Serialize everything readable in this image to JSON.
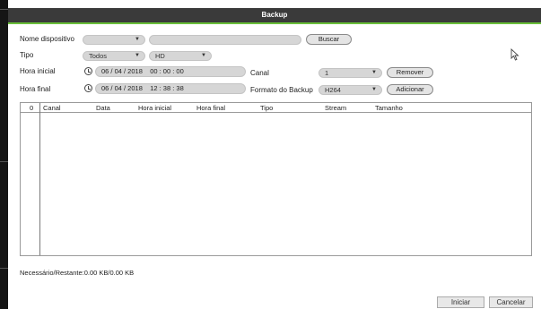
{
  "window": {
    "title": "Backup"
  },
  "form": {
    "device_name": {
      "label": "Nome dispositivo",
      "select_value": "",
      "text_value": "",
      "search_button": "Buscar"
    },
    "type": {
      "label": "Tipo",
      "value1": "Todos",
      "value2": "HD"
    },
    "start_time": {
      "label": "Hora inicial",
      "value": "06 / 04 / 2018    00 : 00 : 00"
    },
    "end_time": {
      "label": "Hora final",
      "value": "06 / 04 / 2018    12 : 38 : 38"
    },
    "channel": {
      "label": "Canal",
      "value": "1",
      "remove_button": "Remover"
    },
    "backup_format": {
      "label": "Formato do Backup",
      "value": "H264",
      "add_button": "Adicionar"
    }
  },
  "table": {
    "columns": [
      "0",
      "Canal",
      "Data",
      "Hora inicial",
      "Hora final",
      "Tipo",
      "Stream",
      "Tamanho"
    ],
    "rows": []
  },
  "footer": {
    "status": "Necessário/Restante:0.00 KB/0.00 KB",
    "start_button": "Iniciar",
    "cancel_button": "Cancelar"
  },
  "colors": {
    "accent": "#6abf3a",
    "titlebar": "#3a3a3a"
  },
  "icons": [
    "clock-icon",
    "dropdown-arrow-icon",
    "cursor-icon"
  ]
}
